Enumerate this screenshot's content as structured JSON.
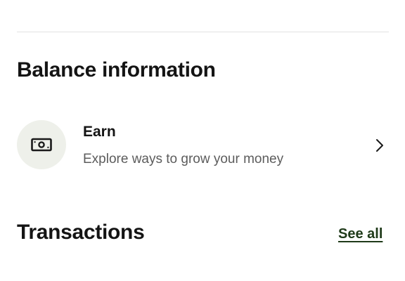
{
  "balance_section": {
    "title": "Balance information",
    "earn": {
      "icon": "cash-icon",
      "title": "Earn",
      "subtitle": "Explore ways to grow your money",
      "chevron_icon": "chevron-right-icon"
    }
  },
  "transactions_section": {
    "title": "Transactions",
    "see_all_label": "See all"
  },
  "colors": {
    "icon_circle_bg": "#eef0ea",
    "link": "#1f3a19",
    "divider": "#e2e2e2"
  }
}
